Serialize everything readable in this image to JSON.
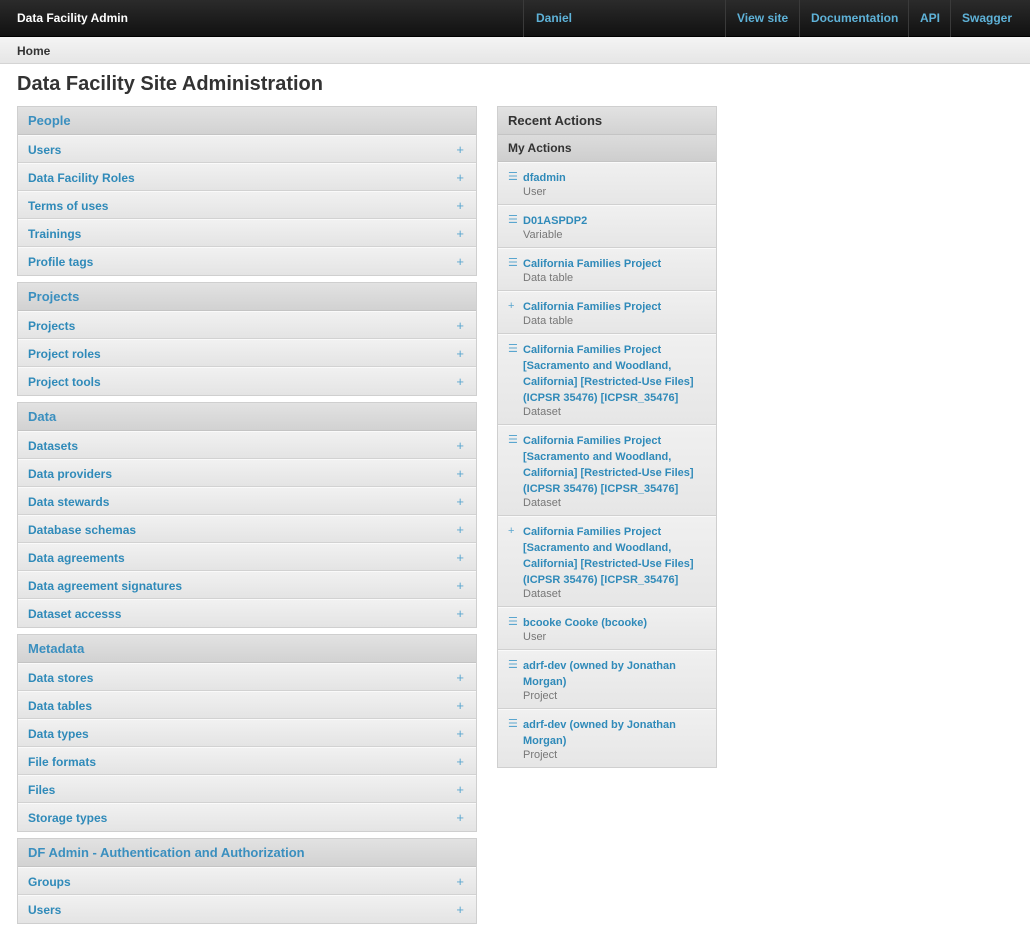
{
  "header": {
    "brand": "Data Facility Admin",
    "user": "Daniel",
    "links": [
      "View site",
      "Documentation",
      "API",
      "Swagger"
    ]
  },
  "breadcrumb": {
    "home": "Home"
  },
  "page": {
    "title": "Data Facility Site Administration"
  },
  "modules": [
    {
      "title": "People",
      "add_symbol": "+",
      "rows": [
        "Users",
        "Data Facility Roles",
        "Terms of uses",
        "Trainings",
        "Profile tags"
      ]
    },
    {
      "title": "Projects",
      "add_symbol": "+",
      "rows": [
        "Projects",
        "Project roles",
        "Project tools"
      ]
    },
    {
      "title": "Data",
      "add_symbol": "+",
      "rows": [
        "Datasets",
        "Data providers",
        "Data stewards",
        "Database schemas",
        "Data agreements",
        "Data agreement signatures",
        "Dataset accesss"
      ]
    },
    {
      "title": "Metadata",
      "add_symbol": "+",
      "rows": [
        "Data stores",
        "Data tables",
        "Data types",
        "File formats",
        "Files",
        "Storage types"
      ]
    },
    {
      "title": "DF Admin - Authentication and Authorization",
      "add_symbol": "+",
      "rows": [
        "Groups",
        "Users"
      ]
    }
  ],
  "recent_actions": {
    "title": "Recent Actions",
    "subtitle": "My Actions",
    "items": [
      {
        "icon": "change-icon",
        "glyph": "☰",
        "title": "dfadmin",
        "type": "User"
      },
      {
        "icon": "change-icon",
        "glyph": "☰",
        "title": "D01ASPDP2",
        "type": "Variable"
      },
      {
        "icon": "change-icon",
        "glyph": "☰",
        "title": "California Families Project",
        "type": "Data table"
      },
      {
        "icon": "add-icon",
        "glyph": "+",
        "title": "California Families Project",
        "type": "Data table"
      },
      {
        "icon": "change-icon",
        "glyph": "☰",
        "title": "California Families Project [Sacramento and Woodland, California] [Restricted-Use Files] (ICPSR 35476) [ICPSR_35476]",
        "type": "Dataset"
      },
      {
        "icon": "change-icon",
        "glyph": "☰",
        "title": "California Families Project [Sacramento and Woodland, California] [Restricted-Use Files] (ICPSR 35476) [ICPSR_35476]",
        "type": "Dataset"
      },
      {
        "icon": "add-icon",
        "glyph": "+",
        "title": "California Families Project [Sacramento and Woodland, California] [Restricted-Use Files] (ICPSR 35476) [ICPSR_35476]",
        "type": "Dataset"
      },
      {
        "icon": "change-icon",
        "glyph": "☰",
        "title": "bcooke Cooke (bcooke)",
        "type": "User"
      },
      {
        "icon": "change-icon",
        "glyph": "☰",
        "title": "adrf-dev (owned by Jonathan Morgan)",
        "type": "Project"
      },
      {
        "icon": "change-icon",
        "glyph": "☰",
        "title": "adrf-dev (owned by Jonathan Morgan)",
        "type": "Project"
      }
    ]
  },
  "colors": {
    "link": "#2f8ab9",
    "header_bg": "#1e1e1e",
    "nav_link": "#5eb2d8"
  }
}
